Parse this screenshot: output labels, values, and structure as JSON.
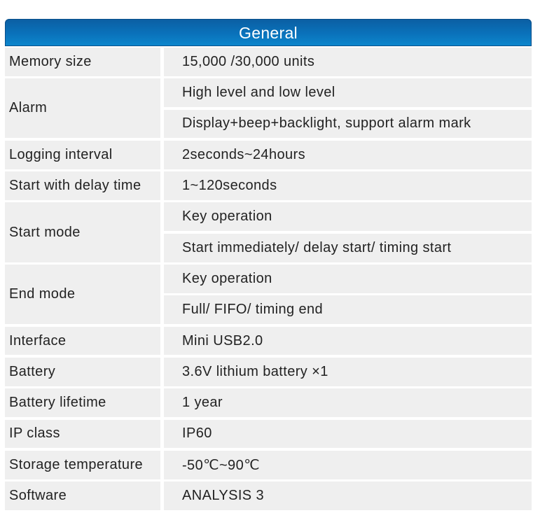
{
  "header": {
    "title": "General",
    "color": "#0a72bb"
  },
  "rows": [
    {
      "label": "Memory size",
      "values": [
        "15,000 /30,000 units"
      ]
    },
    {
      "label": "Alarm",
      "values": [
        "High level and low level",
        "Display+beep+backlight, support alarm mark"
      ]
    },
    {
      "label": "Logging interval",
      "values": [
        "2seconds~24hours"
      ]
    },
    {
      "label": "Start with delay time",
      "values": [
        "1~120seconds"
      ]
    },
    {
      "label": "Start mode",
      "values": [
        "Key operation",
        "Start immediately/ delay start/ timing start"
      ]
    },
    {
      "label": "End mode",
      "values": [
        "Key operation",
        "Full/ FIFO/ timing end"
      ]
    },
    {
      "label": "Interface",
      "values": [
        "Mini USB2.0"
      ]
    },
    {
      "label": "Battery",
      "values": [
        "3.6V lithium battery ×1"
      ]
    },
    {
      "label": "Battery lifetime",
      "values": [
        "1 year"
      ]
    },
    {
      "label": "IP class",
      "values": [
        "IP60"
      ]
    },
    {
      "label": "Storage temperature",
      "values": [
        "-50℃~90℃"
      ]
    },
    {
      "label": "Software",
      "values": [
        "ANALYSIS 3"
      ]
    }
  ]
}
